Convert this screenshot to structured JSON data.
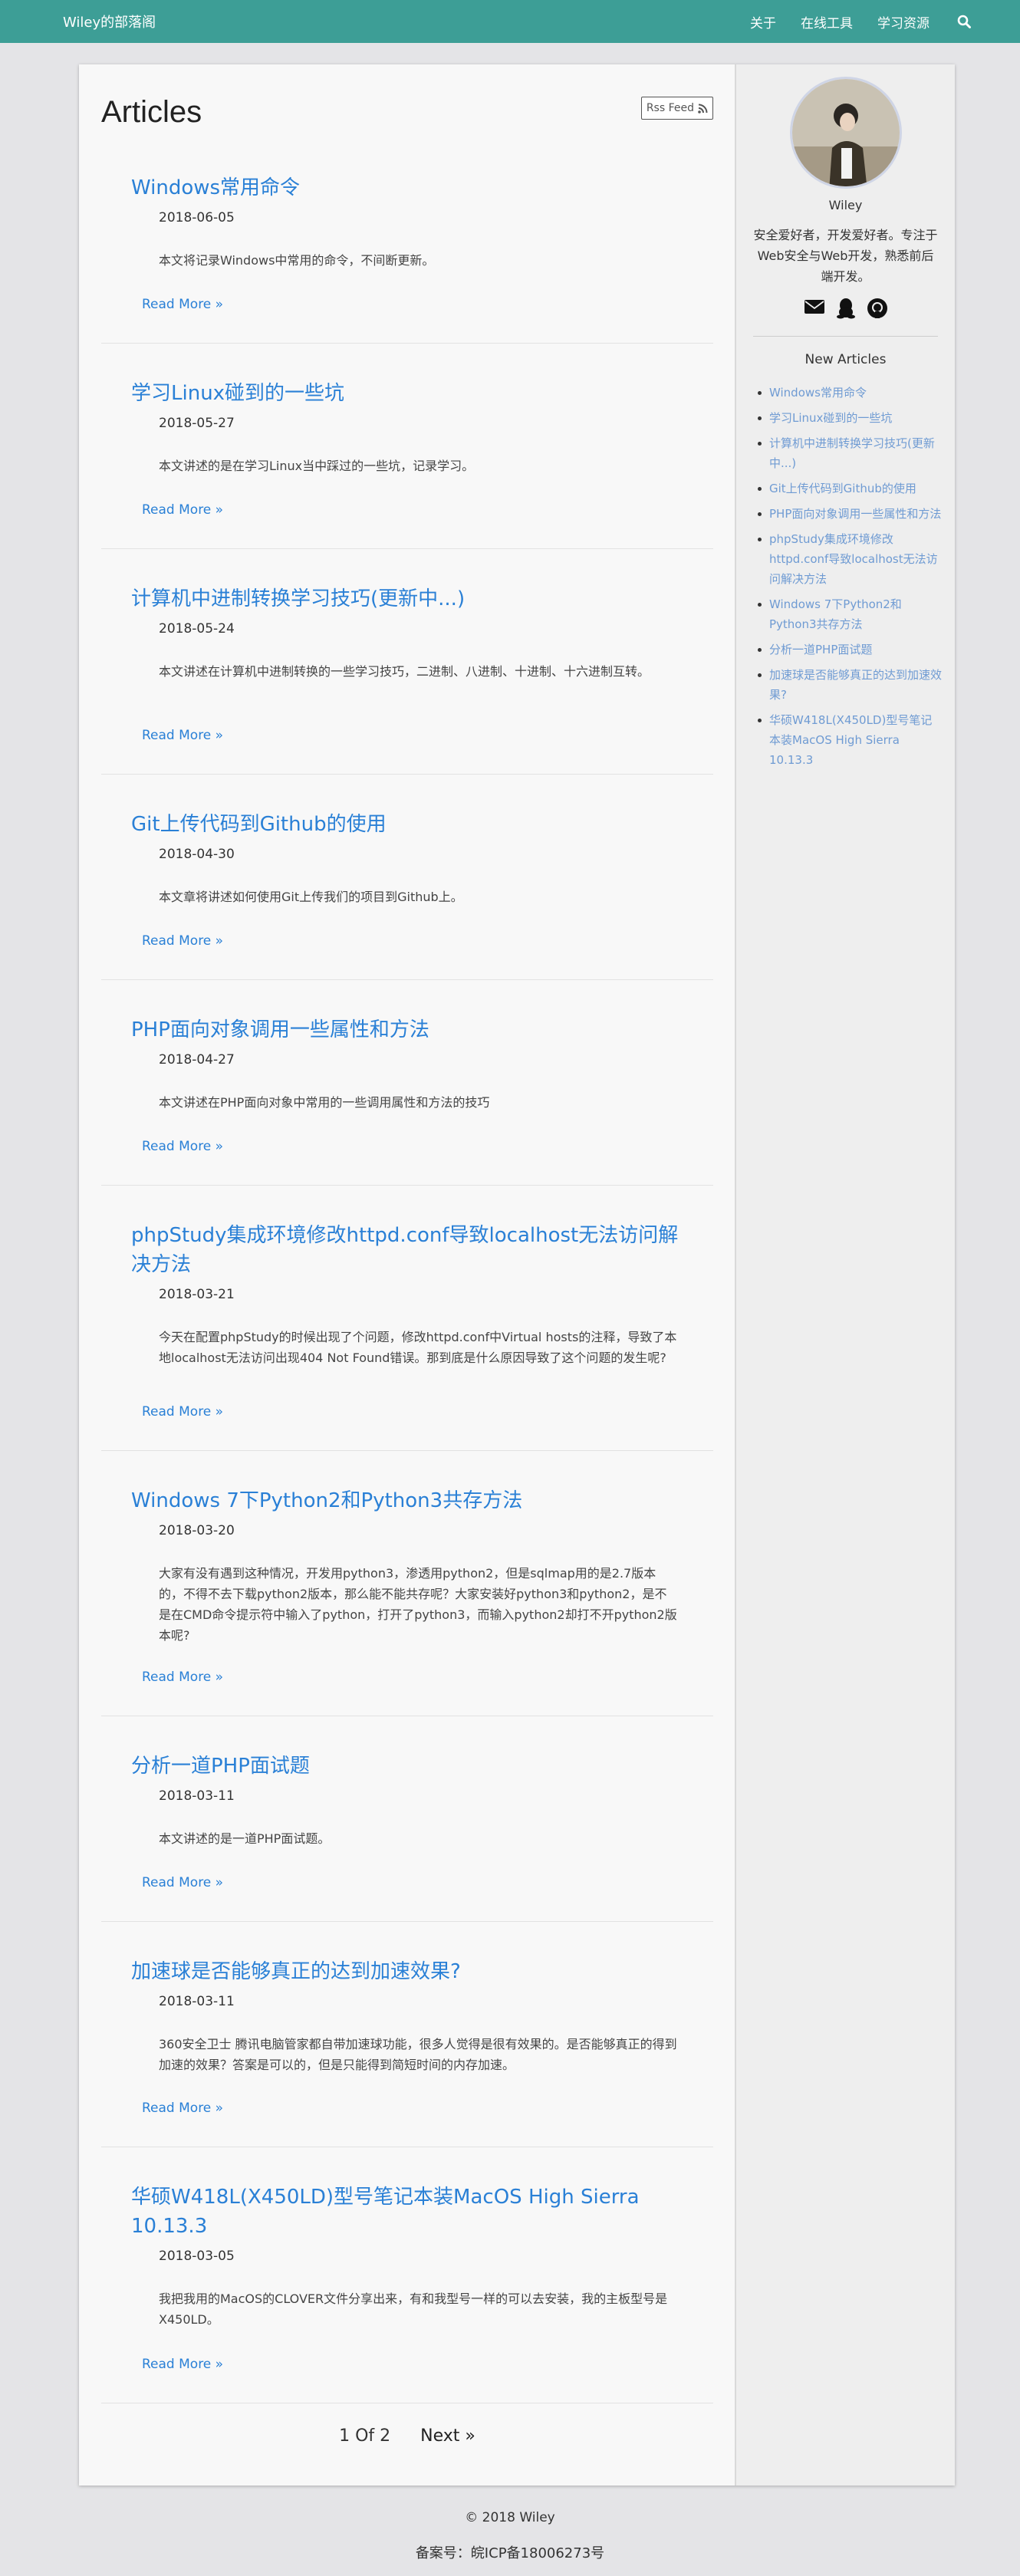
{
  "navbar": {
    "brand": "Wiley的部落阁",
    "links": [
      "关于",
      "在线工具",
      "学习资源"
    ],
    "search_icon": "search-icon"
  },
  "main": {
    "title": "Articles",
    "rss_label": "Rss Feed",
    "read_more": "Read More »",
    "articles": [
      {
        "title": "Windows常用命令",
        "date": "2018-06-05",
        "excerpt": "本文将记录Windows中常用的命令，不间断更新。"
      },
      {
        "title": "学习Linux碰到的一些坑",
        "date": "2018-05-27",
        "excerpt": "本文讲述的是在学习Linux当中踩过的一些坑，记录学习。"
      },
      {
        "title": "计算机中进制转换学习技巧(更新中...)",
        "date": "2018-05-24",
        "excerpt": "本文讲述在计算机中进制转换的一些学习技巧，二进制、八进制、十进制、十六进制互转。"
      },
      {
        "title": "Git上传代码到Github的使用",
        "date": "2018-04-30",
        "excerpt": "本文章将讲述如何使用Git上传我们的项目到Github上。"
      },
      {
        "title": "PHP面向对象调用一些属性和方法",
        "date": "2018-04-27",
        "excerpt": "本文讲述在PHP面向对象中常用的一些调用属性和方法的技巧"
      },
      {
        "title": "phpStudy集成环境修改httpd.conf导致localhost无法访问解决方法",
        "date": "2018-03-21",
        "excerpt": "今天在配置phpStudy的时候出现了个问题，修改httpd.conf中Virtual hosts的注释，导致了本地localhost无法访问出现404 Not Found错误。那到底是什么原因导致了这个问题的发生呢?"
      },
      {
        "title": "Windows 7下Python2和Python3共存方法",
        "date": "2018-03-20",
        "excerpt": "大家有没有遇到这种情况，开发用python3，渗透用python2，但是sqlmap用的是2.7版本的，不得不去下载python2版本，那么能不能共存呢？大家安装好python3和python2，是不是在CMD命令提示符中输入了python，打开了python3，而输入python2却打不开python2版本呢?"
      },
      {
        "title": "分析一道PHP面试题",
        "date": "2018-03-11",
        "excerpt": "本文讲述的是一道PHP面试题。"
      },
      {
        "title": "加速球是否能够真正的达到加速效果?",
        "date": "2018-03-11",
        "excerpt": "360安全卫士 腾讯电脑管家都自带加速球功能，很多人觉得是很有效果的。是否能够真正的得到加速的效果？答案是可以的，但是只能得到简短时间的内存加速。"
      },
      {
        "title": "华硕W418L(X450LD)型号笔记本装MacOS High Sierra 10.13.3",
        "date": "2018-03-05",
        "excerpt": "我把我用的MacOS的CLOVER文件分享出来，有和我型号一样的可以去安装，我的主板型号是X450LD。"
      }
    ],
    "pager": {
      "status": "1 Of 2",
      "next": "Next »"
    }
  },
  "sidebar": {
    "author": "Wiley",
    "bio": "安全爱好者，开发爱好者。专注于Web安全与Web开发，熟悉前后端开发。",
    "social_icons": [
      "envelope-icon",
      "qq-icon",
      "github-icon"
    ],
    "new_title": "New Articles",
    "new_articles": [
      "Windows常用命令",
      "学习Linux碰到的一些坑",
      "计算机中进制转换学习技巧(更新中...)",
      "Git上传代码到Github的使用",
      "PHP面向对象调用一些属性和方法",
      "phpStudy集成环境修改httpd.conf导致localhost无法访问解决方法",
      "Windows 7下Python2和Python3共存方法",
      "分析一道PHP面试题",
      "加速球是否能够真正的达到加速效果?",
      "华硕W418L(X450LD)型号笔记本装MacOS High Sierra 10.13.3"
    ]
  },
  "footer": {
    "copyright": "© 2018 Wiley",
    "icp": "备案号：皖ICP备18006273号"
  },
  "colors": {
    "navbar": "#3d9e96",
    "link": "#2a80d6",
    "sidebar_link": "#6f9bd3"
  }
}
